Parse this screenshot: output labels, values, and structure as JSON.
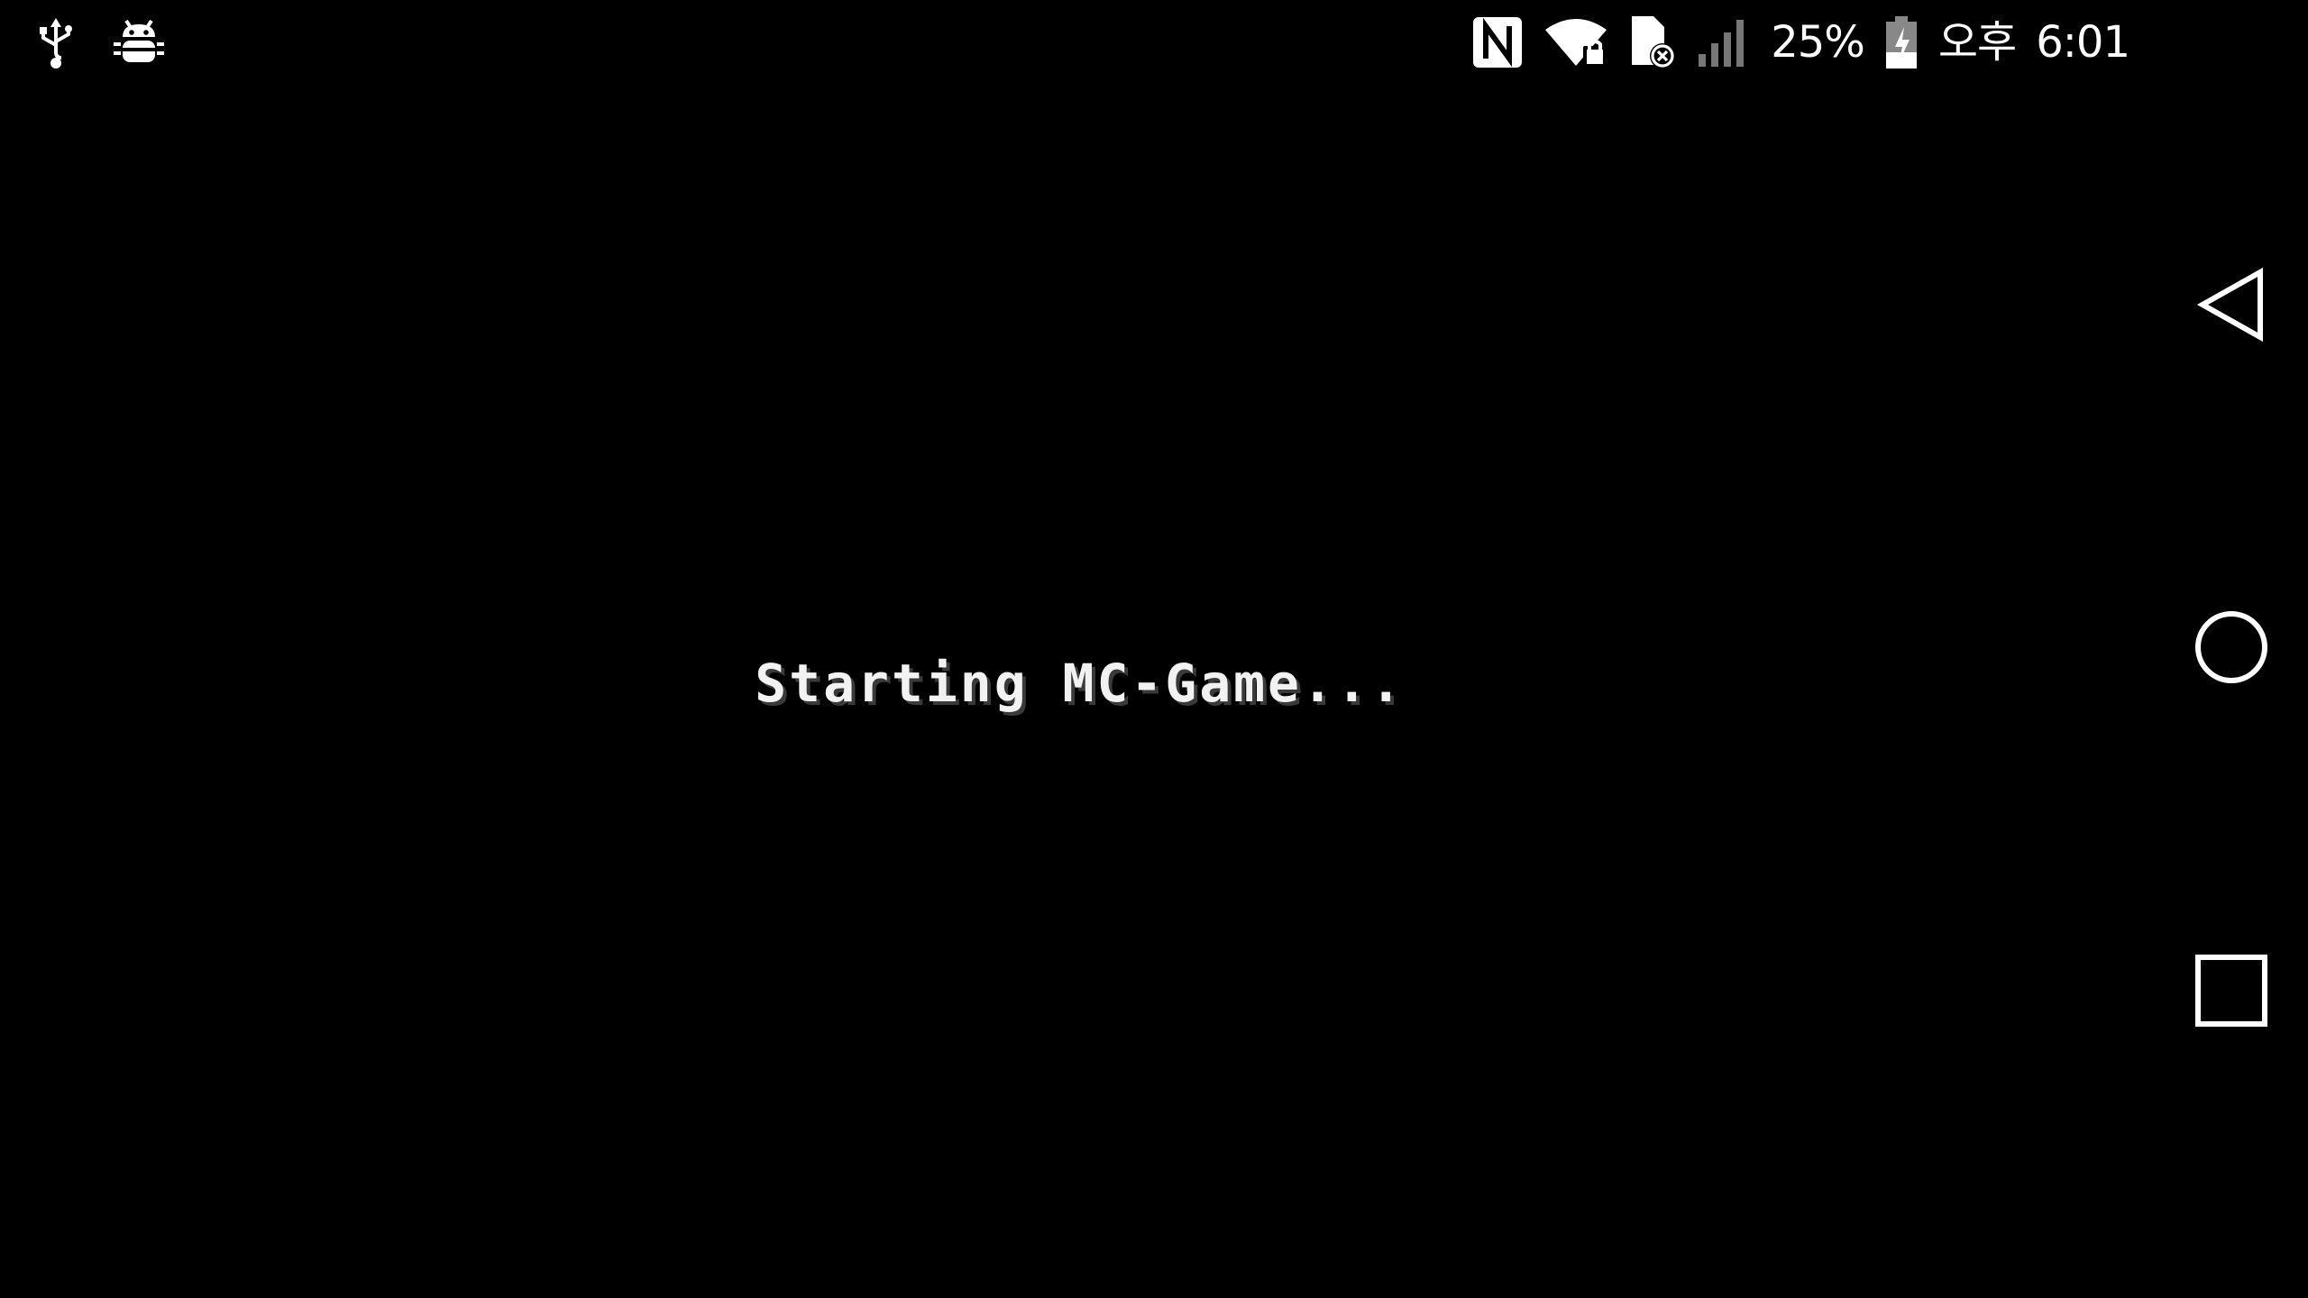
{
  "status_bar": {
    "left_icons": [
      "usb-icon",
      "android-debug-icon"
    ],
    "right_icons": [
      "nfc-icon",
      "wifi-locked-icon",
      "sim-missing-icon",
      "signal-icon",
      "battery-charging-icon"
    ],
    "battery_percent": "25%",
    "ampm": "오후",
    "time": "6:01"
  },
  "main": {
    "loading_text": "Starting MC-Game..."
  },
  "nav_bar": {
    "buttons": [
      "back-icon",
      "home-icon",
      "recents-icon"
    ]
  },
  "colors": {
    "background": "#000000",
    "foreground": "#ffffff",
    "text_shadow": "#3a3a3a"
  }
}
